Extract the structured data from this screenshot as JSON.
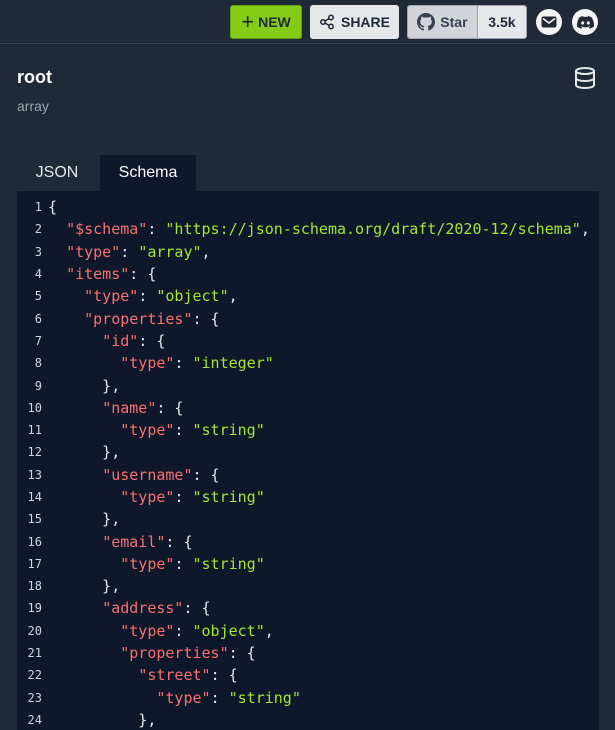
{
  "toolbar": {
    "new_label": "NEW",
    "share_label": "SHARE",
    "star_label": "Star",
    "star_count": "3.5k"
  },
  "root": {
    "title": "root",
    "subtitle": "array"
  },
  "tabs": [
    {
      "label": "JSON",
      "active": false
    },
    {
      "label": "Schema",
      "active": true
    }
  ],
  "code_lines": [
    [
      {
        "t": "p",
        "v": "{"
      }
    ],
    [
      {
        "t": "p",
        "v": "  "
      },
      {
        "t": "k",
        "v": "\"$schema\""
      },
      {
        "t": "p",
        "v": ": "
      },
      {
        "t": "s",
        "v": "\"https://json-schema.org/draft/2020-12/schema\""
      },
      {
        "t": "p",
        "v": ","
      }
    ],
    [
      {
        "t": "p",
        "v": "  "
      },
      {
        "t": "k",
        "v": "\"type\""
      },
      {
        "t": "p",
        "v": ": "
      },
      {
        "t": "s",
        "v": "\"array\""
      },
      {
        "t": "p",
        "v": ","
      }
    ],
    [
      {
        "t": "p",
        "v": "  "
      },
      {
        "t": "k",
        "v": "\"items\""
      },
      {
        "t": "p",
        "v": ": {"
      }
    ],
    [
      {
        "t": "p",
        "v": "    "
      },
      {
        "t": "k",
        "v": "\"type\""
      },
      {
        "t": "p",
        "v": ": "
      },
      {
        "t": "s",
        "v": "\"object\""
      },
      {
        "t": "p",
        "v": ","
      }
    ],
    [
      {
        "t": "p",
        "v": "    "
      },
      {
        "t": "k",
        "v": "\"properties\""
      },
      {
        "t": "p",
        "v": ": {"
      }
    ],
    [
      {
        "t": "p",
        "v": "      "
      },
      {
        "t": "k",
        "v": "\"id\""
      },
      {
        "t": "p",
        "v": ": {"
      }
    ],
    [
      {
        "t": "p",
        "v": "        "
      },
      {
        "t": "k",
        "v": "\"type\""
      },
      {
        "t": "p",
        "v": ": "
      },
      {
        "t": "s",
        "v": "\"integer\""
      }
    ],
    [
      {
        "t": "p",
        "v": "      },"
      }
    ],
    [
      {
        "t": "p",
        "v": "      "
      },
      {
        "t": "k",
        "v": "\"name\""
      },
      {
        "t": "p",
        "v": ": {"
      }
    ],
    [
      {
        "t": "p",
        "v": "        "
      },
      {
        "t": "k",
        "v": "\"type\""
      },
      {
        "t": "p",
        "v": ": "
      },
      {
        "t": "s",
        "v": "\"string\""
      }
    ],
    [
      {
        "t": "p",
        "v": "      },"
      }
    ],
    [
      {
        "t": "p",
        "v": "      "
      },
      {
        "t": "k",
        "v": "\"username\""
      },
      {
        "t": "p",
        "v": ": {"
      }
    ],
    [
      {
        "t": "p",
        "v": "        "
      },
      {
        "t": "k",
        "v": "\"type\""
      },
      {
        "t": "p",
        "v": ": "
      },
      {
        "t": "s",
        "v": "\"string\""
      }
    ],
    [
      {
        "t": "p",
        "v": "      },"
      }
    ],
    [
      {
        "t": "p",
        "v": "      "
      },
      {
        "t": "k",
        "v": "\"email\""
      },
      {
        "t": "p",
        "v": ": {"
      }
    ],
    [
      {
        "t": "p",
        "v": "        "
      },
      {
        "t": "k",
        "v": "\"type\""
      },
      {
        "t": "p",
        "v": ": "
      },
      {
        "t": "s",
        "v": "\"string\""
      }
    ],
    [
      {
        "t": "p",
        "v": "      },"
      }
    ],
    [
      {
        "t": "p",
        "v": "      "
      },
      {
        "t": "k",
        "v": "\"address\""
      },
      {
        "t": "p",
        "v": ": {"
      }
    ],
    [
      {
        "t": "p",
        "v": "        "
      },
      {
        "t": "k",
        "v": "\"type\""
      },
      {
        "t": "p",
        "v": ": "
      },
      {
        "t": "s",
        "v": "\"object\""
      },
      {
        "t": "p",
        "v": ","
      }
    ],
    [
      {
        "t": "p",
        "v": "        "
      },
      {
        "t": "k",
        "v": "\"properties\""
      },
      {
        "t": "p",
        "v": ": {"
      }
    ],
    [
      {
        "t": "p",
        "v": "          "
      },
      {
        "t": "k",
        "v": "\"street\""
      },
      {
        "t": "p",
        "v": ": {"
      }
    ],
    [
      {
        "t": "p",
        "v": "            "
      },
      {
        "t": "k",
        "v": "\"type\""
      },
      {
        "t": "p",
        "v": ": "
      },
      {
        "t": "s",
        "v": "\"string\""
      }
    ],
    [
      {
        "t": "p",
        "v": "          },"
      }
    ]
  ],
  "icons": {
    "share": "share-icon",
    "star": "github-icon",
    "mail": "mail-icon",
    "discord": "discord-icon",
    "database": "database-icon"
  },
  "colors": {
    "background": "#1f2937",
    "editor_background": "#0f172a",
    "key": "#f87171",
    "string": "#a3e635",
    "new_button": "#84cc16"
  }
}
